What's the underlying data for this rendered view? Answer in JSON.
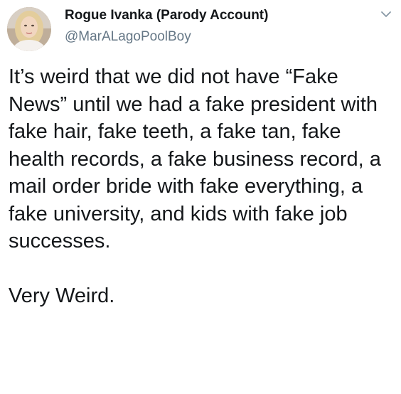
{
  "author": {
    "display_name": "Rogue Ivanka (Parody Account)",
    "handle": "@MarALagoPoolBoy",
    "avatar_icon": "profile-photo"
  },
  "menu": {
    "icon": "chevron-down-icon"
  },
  "tweet": {
    "paragraphs": [
      "It’s weird that we did not have “Fake News” until we had a fake president with fake hair, fake teeth, a fake tan, fake health records, a fake business record, a mail order bride with fake everything, a fake university, and kids with fake job successes.",
      "Very Weird."
    ]
  },
  "colors": {
    "text": "#14171a",
    "secondary_text": "#657786",
    "background": "#ffffff"
  }
}
